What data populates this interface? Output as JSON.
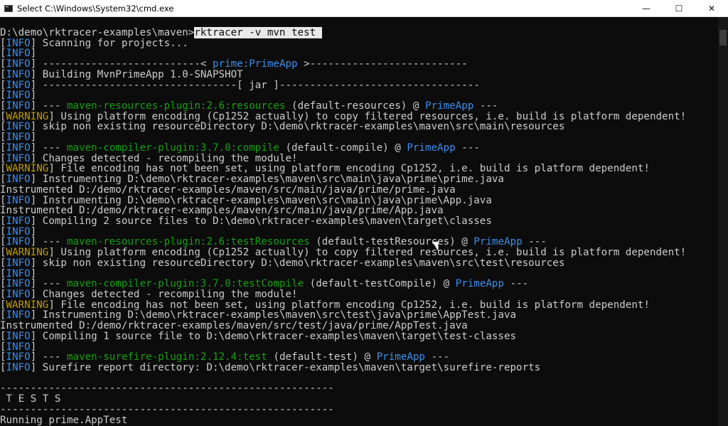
{
  "window": {
    "title": "Select C:\\Windows\\System32\\cmd.exe",
    "controls": {
      "minimize": "—",
      "maximize": "☐",
      "close": "✕"
    },
    "accent": "#3b8eea",
    "green": "#13a10e"
  },
  "terminal": {
    "lines": [
      {
        "t": "prompt",
        "path": "D:\\demo\\rktracer-examples\\maven>",
        "cmd": "rktracer -v mvn test "
      },
      {
        "t": "info",
        "text": " Scanning for projects..."
      },
      {
        "t": "info",
        "text": ""
      },
      {
        "t": "info_parts",
        "parts": [
          {
            "c": "",
            " s": ""
          }
        ],
        "text_before": " --------------------------< ",
        "blue": "prime:PrimeApp",
        "text_after": " >--------------------------"
      },
      {
        "t": "info",
        "text": " Building MvnPrimeApp 1.0-SNAPSHOT"
      },
      {
        "t": "info",
        "text": " --------------------------------[ jar ]---------------------------------"
      },
      {
        "t": "info",
        "text": ""
      },
      {
        "t": "plugin",
        "green": "maven-resources-plugin:2.6:resources",
        "mid": " (default-resources) @ ",
        "blue": "PrimeApp",
        "end": " ---"
      },
      {
        "t": "warn",
        "text": " Using platform encoding (Cp1252 actually) to copy filtered resources, i.e. build is platform dependent!"
      },
      {
        "t": "info",
        "text": " skip non existing resourceDirectory D:\\demo\\rktracer-examples\\maven\\src\\main\\resources"
      },
      {
        "t": "info",
        "text": ""
      },
      {
        "t": "plugin",
        "green": "maven-compiler-plugin:3.7.0:compile",
        "mid": " (default-compile) @ ",
        "blue": "PrimeApp",
        "end": " ---"
      },
      {
        "t": "info",
        "text": " Changes detected - recompiling the module!"
      },
      {
        "t": "warn",
        "text": " File encoding has not been set, using platform encoding Cp1252, i.e. build is platform dependent!"
      },
      {
        "t": "info",
        "text": " Instrumenting D:\\demo\\rktracer-examples\\maven\\src\\main\\java\\prime\\prime.java"
      },
      {
        "t": "plain",
        "text": "Instrumented D:/demo/rktracer-examples/maven/src/main/java/prime/prime.java"
      },
      {
        "t": "info",
        "text": " Instrumenting D:\\demo\\rktracer-examples\\maven\\src\\main\\java\\prime\\App.java"
      },
      {
        "t": "plain",
        "text": "Instrumented D:/demo/rktracer-examples/maven/src/main/java/prime/App.java"
      },
      {
        "t": "info",
        "text": " Compiling 2 source files to D:\\demo\\rktracer-examples\\maven\\target\\classes"
      },
      {
        "t": "info",
        "text": ""
      },
      {
        "t": "plugin",
        "green": "maven-resources-plugin:2.6:testResources",
        "mid": " (default-testResources) @ ",
        "blue": "PrimeApp",
        "end": " ---"
      },
      {
        "t": "warn",
        "text": " Using platform encoding (Cp1252 actually) to copy filtered resources, i.e. build is platform dependent!"
      },
      {
        "t": "info",
        "text": " skip non existing resourceDirectory D:\\demo\\rktracer-examples\\maven\\src\\test\\resources"
      },
      {
        "t": "info",
        "text": ""
      },
      {
        "t": "plugin",
        "green": "maven-compiler-plugin:3.7.0:testCompile",
        "mid": " (default-testCompile) @ ",
        "blue": "PrimeApp",
        "end": " ---"
      },
      {
        "t": "info",
        "text": " Changes detected - recompiling the module!"
      },
      {
        "t": "warn",
        "text": " File encoding has not been set, using platform encoding Cp1252, i.e. build is platform dependent!"
      },
      {
        "t": "info",
        "text": " Instrumenting D:\\demo\\rktracer-examples\\maven\\src\\test\\java\\prime\\AppTest.java"
      },
      {
        "t": "plain",
        "text": "Instrumented D:/demo/rktracer-examples/maven/src/test/java/prime/AppTest.java"
      },
      {
        "t": "info",
        "text": " Compiling 1 source file to D:\\demo\\rktracer-examples\\maven\\target\\test-classes"
      },
      {
        "t": "info",
        "text": ""
      },
      {
        "t": "plugin",
        "green": "maven-surefire-plugin:2.12.4:test",
        "mid": " (default-test) @ ",
        "blue": "PrimeApp",
        "end": " ---"
      },
      {
        "t": "info",
        "text": " Surefire report directory: D:\\demo\\rktracer-examples\\maven\\target\\surefire-reports"
      },
      {
        "t": "plain",
        "text": ""
      },
      {
        "t": "plain",
        "text": "-------------------------------------------------------"
      },
      {
        "t": "plain",
        "text": " T E S T S"
      },
      {
        "t": "plain",
        "text": "-------------------------------------------------------"
      },
      {
        "t": "plain",
        "text": "Running prime.AppTest"
      }
    ],
    "tags": {
      "info": "INFO",
      "warn": "WARNING",
      "plugin_prefix": " --- "
    }
  }
}
